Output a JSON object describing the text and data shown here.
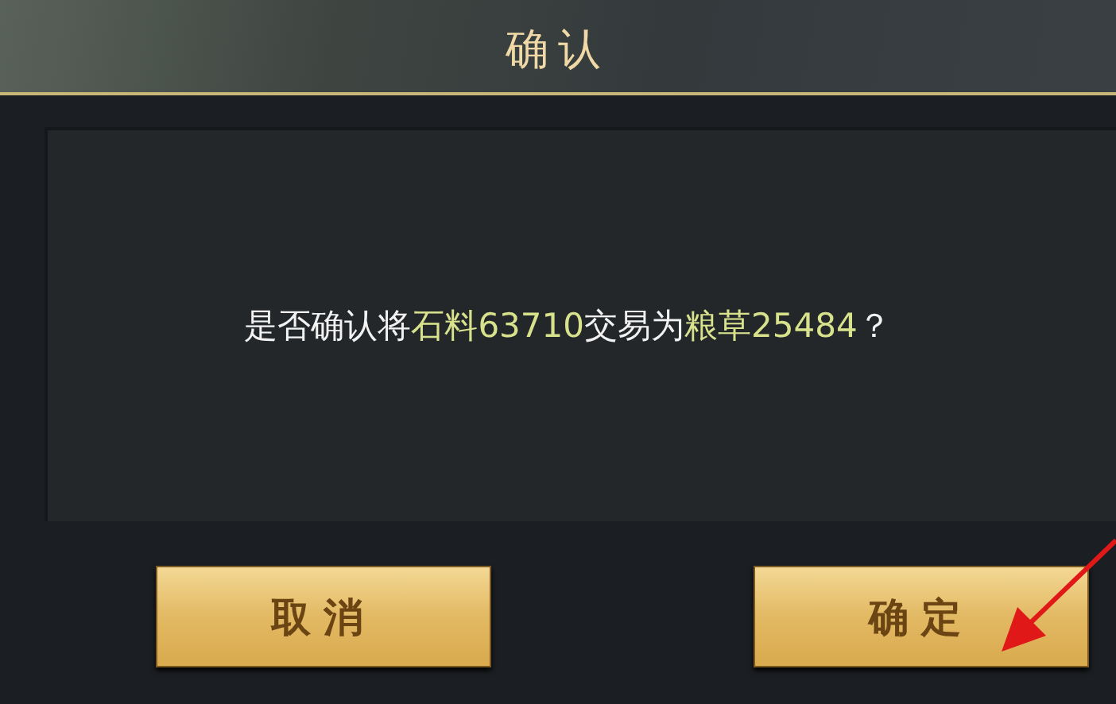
{
  "dialog": {
    "title": "确认",
    "message": [
      {
        "kind": "plain",
        "text": "是否确认将"
      },
      {
        "kind": "highlight",
        "text": "石料63710"
      },
      {
        "kind": "plain",
        "text": "交易为"
      },
      {
        "kind": "highlight",
        "text": "粮草25484"
      },
      {
        "kind": "plain",
        "text": "？"
      }
    ],
    "buttons": [
      "取消",
      "确定"
    ]
  }
}
